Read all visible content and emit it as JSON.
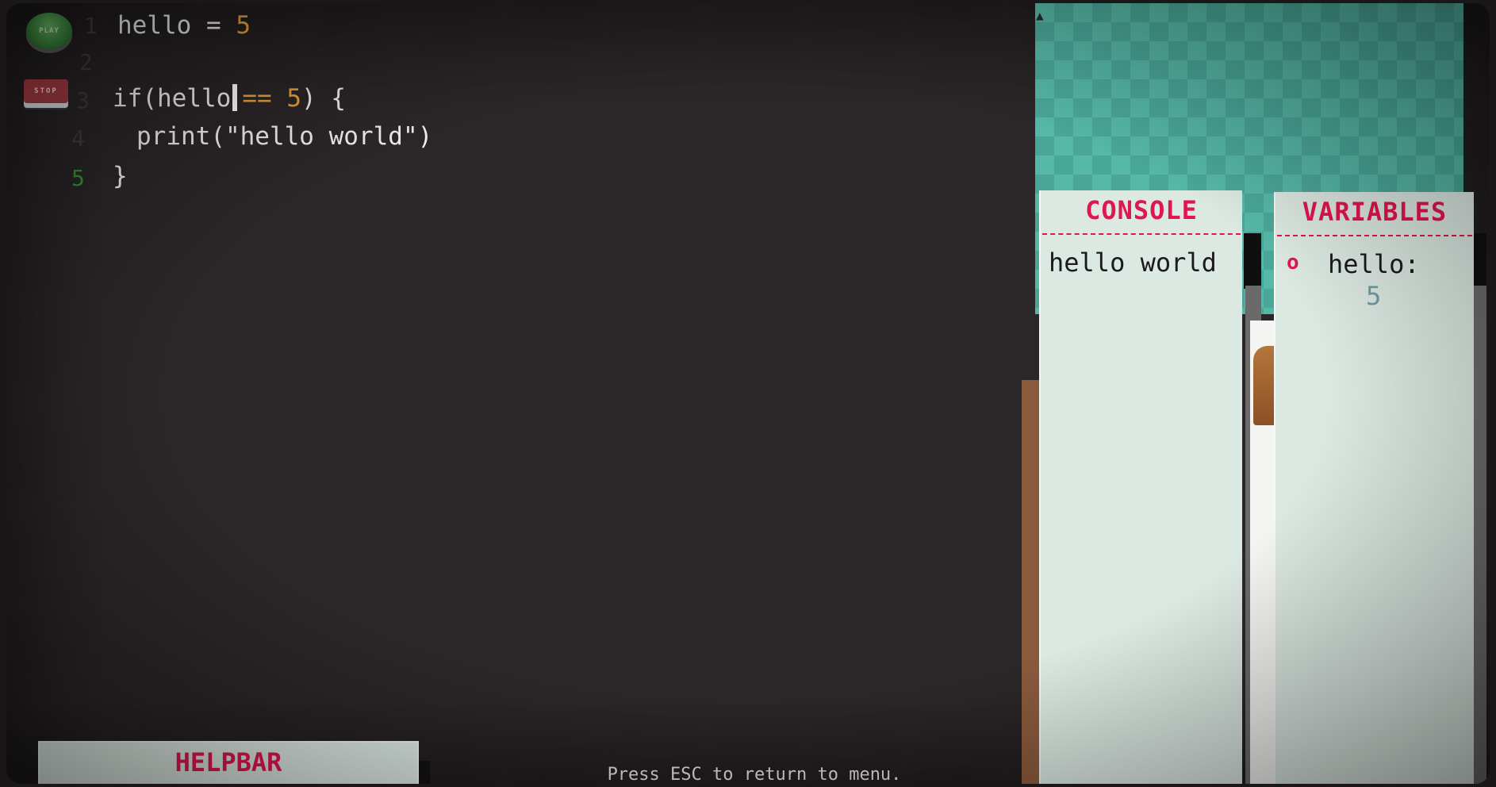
{
  "controls": {
    "play_label": "PLAY",
    "stop_label": "STOP"
  },
  "editor": {
    "lines": [
      {
        "number": "1",
        "text": "hello = ",
        "value": "5"
      },
      {
        "number": "2",
        "text": ""
      },
      {
        "number": "3",
        "pre": "if(hello",
        "op": "==",
        "value": "5",
        "post": ") {"
      },
      {
        "number": "4",
        "text": "print(\"hello world\")"
      },
      {
        "number": "5",
        "text": "}"
      }
    ],
    "active_line": "5"
  },
  "console": {
    "title": "CONSOLE",
    "output": [
      "hello world"
    ]
  },
  "variables": {
    "title": "VARIABLES",
    "items": [
      {
        "name": "hello:",
        "value": "5"
      }
    ]
  },
  "helpbar": {
    "title": "HELPBAR"
  },
  "hint": "Press ESC to return to menu.",
  "colors": {
    "accent": "#e1154f",
    "number": "#e8a03a",
    "active_line_number": "#2f8f36",
    "panel_bg": "#dce8e2",
    "editor_bg": "#2b2628"
  }
}
